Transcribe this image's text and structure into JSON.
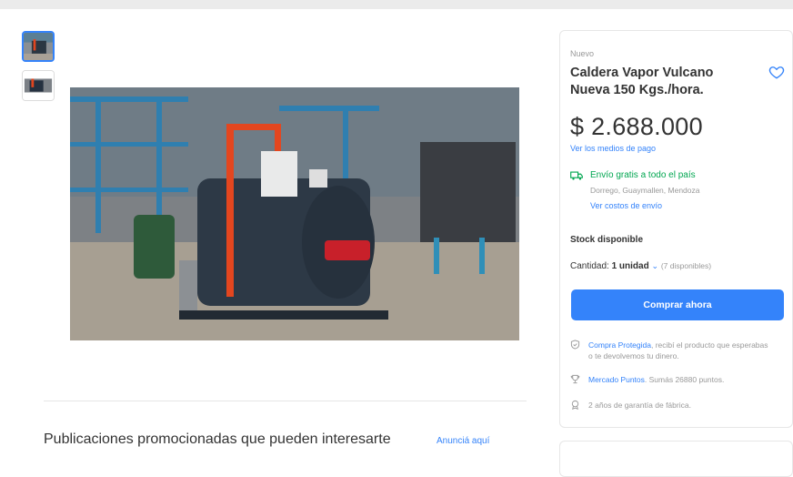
{
  "gallery": {
    "thumbs": [
      "thumbnail-1",
      "thumbnail-2"
    ]
  },
  "product": {
    "condition": "Nuevo",
    "title": "Caldera Vapor Vulcano Nueva 150 Kgs./hora.",
    "price": "$ 2.688.000",
    "payment_link": "Ver los medios de pago"
  },
  "shipping": {
    "text": "Envío gratis a todo el país",
    "location": "Dorrego, Guaymallen, Mendoza",
    "costs_link": "Ver costos de envío",
    "color": "#00a650"
  },
  "stock": {
    "title": "Stock disponible",
    "quantity_label": "Cantidad:",
    "quantity_value": "1 unidad",
    "available": "(7 disponibles)"
  },
  "buy_button": {
    "label": "Comprar ahora",
    "color": "#3483fa"
  },
  "features": {
    "protected_link": "Compra Protegida",
    "protected_text": ", recibí el producto que esperabas o te devolvemos tu dinero.",
    "points_link": "Mercado Puntos",
    "points_text": ". Sumás 26880 puntos.",
    "warranty": "2 años de garantía de fábrica."
  },
  "promo": {
    "title": "Publicaciones promocionadas que pueden interesarte",
    "link": "Anunciá aquí"
  },
  "icons": [
    "heart-icon",
    "truck-icon",
    "shield-icon",
    "trophy-icon",
    "ribbon-icon",
    "chevron-down-icon"
  ]
}
